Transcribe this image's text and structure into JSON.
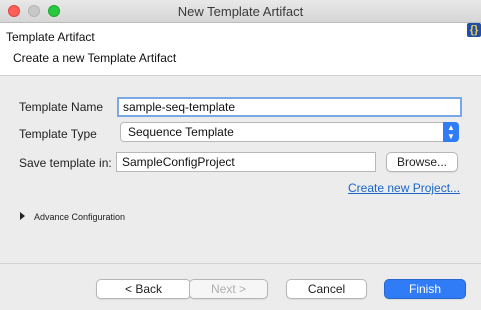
{
  "window": {
    "title": "New Template Artifact"
  },
  "header": {
    "title": "Template Artifact",
    "subtitle": "Create a new Template Artifact",
    "icon": "template-logo-icon",
    "icon_glyph": "{}"
  },
  "form": {
    "name_label": "Template Name",
    "name_value": "sample-seq-template",
    "type_label": "Template Type",
    "type_value": "Sequence Template",
    "save_label": "Save template in:",
    "save_value": "SampleConfigProject",
    "browse_label": "Browse...",
    "create_project_link": "Create new Project...",
    "advance_label": "Advance Configuration"
  },
  "buttons": {
    "back": "< Back",
    "next": "Next >",
    "cancel": "Cancel",
    "finish": "Finish"
  },
  "colors": {
    "accent": "#2f7cf6",
    "link": "#1a66c8",
    "close": "#fe5f57",
    "zoom": "#28c840"
  }
}
